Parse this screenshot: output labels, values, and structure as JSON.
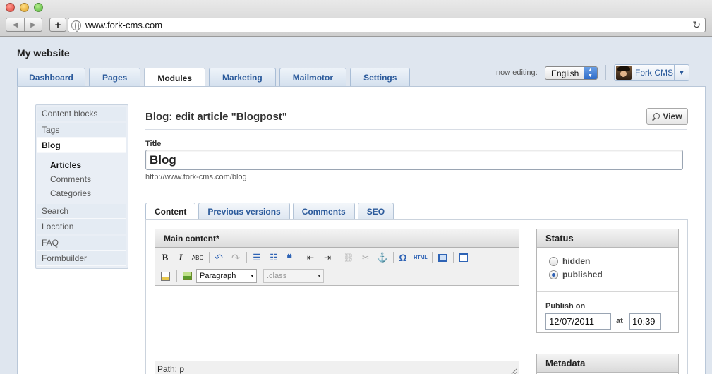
{
  "browser": {
    "url": "www.fork-cms.com"
  },
  "site": {
    "title": "My website"
  },
  "main_tabs": [
    {
      "label": "Dashboard"
    },
    {
      "label": "Pages"
    },
    {
      "label": "Modules"
    },
    {
      "label": "Marketing"
    },
    {
      "label": "Mailmotor"
    },
    {
      "label": "Settings"
    }
  ],
  "header": {
    "now_editing_label": "now editing:",
    "language": "English",
    "user_name": "Fork CMS"
  },
  "sidebar": {
    "items": [
      {
        "label": "Content blocks"
      },
      {
        "label": "Tags"
      },
      {
        "label": "Blog"
      },
      {
        "label": "Search"
      },
      {
        "label": "Location"
      },
      {
        "label": "FAQ"
      },
      {
        "label": "Formbuilder"
      }
    ],
    "blog_sub": [
      {
        "label": "Articles"
      },
      {
        "label": "Comments"
      },
      {
        "label": "Categories"
      }
    ]
  },
  "page": {
    "heading": "Blog: edit article \"Blogpost\"",
    "view_button": "View",
    "title_label": "Title",
    "title_value": "Blog",
    "title_url": "http://www.fork-cms.com/blog"
  },
  "sub_tabs": [
    {
      "label": "Content"
    },
    {
      "label": "Previous versions"
    },
    {
      "label": "Comments"
    },
    {
      "label": "SEO"
    }
  ],
  "editor": {
    "heading": "Main content*",
    "format_value": "Paragraph",
    "class_placeholder": ".class",
    "path": "Path: p",
    "tools": {
      "bold": "B",
      "italic": "I",
      "strike": "ABC",
      "undo": "↶",
      "redo": "↷",
      "bullets": "☰",
      "numbers": "☷",
      "quote": "❝",
      "outdent": "⇤",
      "indent": "⇥",
      "link": "⛓",
      "unlink": "✂",
      "anchor": "⚓",
      "special_char": "Ω",
      "html": "HTML"
    }
  },
  "status": {
    "heading": "Status",
    "options": [
      {
        "label": "hidden",
        "selected": false
      },
      {
        "label": "published",
        "selected": true
      }
    ],
    "publish_label": "Publish on",
    "date": "12/07/2011",
    "at_label": "at",
    "time": "10:39"
  },
  "metadata": {
    "heading": "Metadata"
  },
  "colors": {
    "link_blue": "#2b5a9b",
    "panel_bg": "#dfe6ef"
  }
}
